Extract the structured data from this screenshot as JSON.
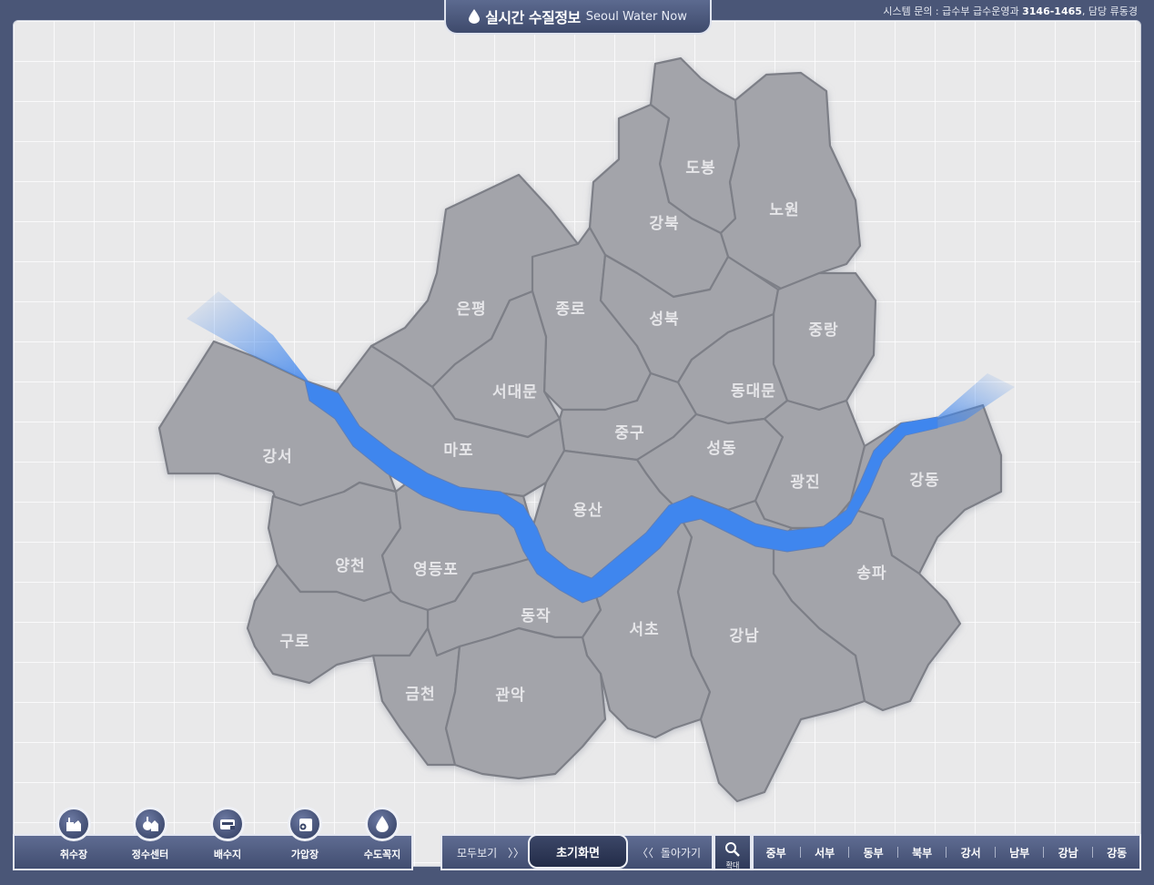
{
  "header": {
    "title_ko": "실시간 수질정보",
    "title_en": "Seoul Water Now",
    "contact_prefix": "시스템 문의 : 급수부 급수운영과",
    "contact_phone": "3146-1465",
    "contact_suffix": ", 담당 류동경"
  },
  "districts": {
    "dobong": "도봉",
    "nowon": "노원",
    "gangbuk": "강북",
    "eunpyeong": "은평",
    "jongno": "종로",
    "seongbuk": "성북",
    "jungnang": "중랑",
    "seodaemun": "서대문",
    "dongdaemun": "동대문",
    "junggu": "중구",
    "mapo": "마포",
    "seongdong": "성동",
    "gangseo": "강서",
    "gwangjin": "광진",
    "gangdong": "강동",
    "yongsan": "용산",
    "yangcheon": "양천",
    "yeongdeungpo": "영등포",
    "songpa": "송파",
    "dongjak": "동작",
    "seocho": "서초",
    "gangnam": "강남",
    "guro": "구로",
    "geumcheon": "금천",
    "gwanak": "관악"
  },
  "facilities": [
    {
      "label": "취수장",
      "icon": "intake-station-icon"
    },
    {
      "label": "정수센터",
      "icon": "purification-center-icon"
    },
    {
      "label": "배수지",
      "icon": "reservoir-icon"
    },
    {
      "label": "가압장",
      "icon": "pumping-station-icon"
    },
    {
      "label": "수도꼭지",
      "icon": "water-drop-icon"
    }
  ],
  "nav": {
    "view_all": "모두보기",
    "view_all_arrow": "〉〉",
    "home": "초기화면",
    "back_arrow": "〈〈",
    "back": "돌아가기",
    "zoom": "확대"
  },
  "regions": [
    "중부",
    "서부",
    "동부",
    "북부",
    "강서",
    "남부",
    "강남",
    "강동"
  ],
  "colors": {
    "background": "#4a5677",
    "district_fill": "#a3a4aa",
    "river": "#3f86ee",
    "panel": "#e9e9ea"
  }
}
